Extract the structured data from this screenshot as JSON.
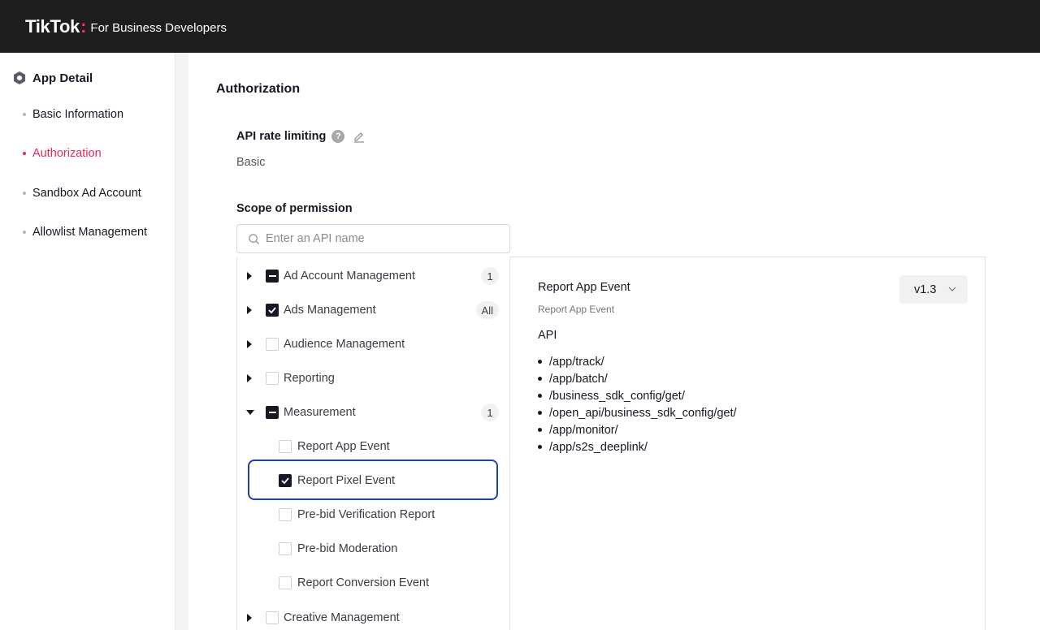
{
  "header": {
    "brand": "TikTok",
    "brand_dot": ":",
    "subtitle": "For Business Developers"
  },
  "sidebar": {
    "title": "App Detail",
    "items": [
      {
        "label": "Basic Information",
        "active": false
      },
      {
        "label": "Authorization",
        "active": true
      },
      {
        "label": "Sandbox Ad Account",
        "active": false
      },
      {
        "label": "Allowlist Management",
        "active": false
      }
    ]
  },
  "main": {
    "title": "Authorization",
    "rate_limit_label": "API rate limiting",
    "rate_limit_value": "Basic",
    "scope_label": "Scope of permission",
    "search_placeholder": "Enter an API name"
  },
  "tree": [
    {
      "label": "Ad Account Management",
      "state": "partial",
      "badge": "1",
      "expand": "collapsed"
    },
    {
      "label": "Ads Management",
      "state": "checked",
      "badge": "All",
      "expand": "collapsed"
    },
    {
      "label": "Audience Management",
      "state": "unchecked",
      "badge": "",
      "expand": "collapsed"
    },
    {
      "label": "Reporting",
      "state": "unchecked",
      "badge": "",
      "expand": "collapsed"
    },
    {
      "label": "Measurement",
      "state": "partial",
      "badge": "1",
      "expand": "expanded"
    },
    {
      "label": "Report App Event",
      "state": "unchecked",
      "child": true
    },
    {
      "label": "Report Pixel Event",
      "state": "checked",
      "child": true
    },
    {
      "label": "Pre-bid Verification Report",
      "state": "unchecked",
      "child": true
    },
    {
      "label": "Pre-bid Moderation",
      "state": "unchecked",
      "child": true
    },
    {
      "label": "Report Conversion Event",
      "state": "unchecked",
      "child": true
    },
    {
      "label": "Creative Management",
      "state": "unchecked",
      "badge": "",
      "expand": "collapsed"
    }
  ],
  "detail": {
    "title": "Report App Event",
    "subtitle": "Report App Event",
    "api_heading": "API",
    "apis": [
      "/app/track/",
      "/app/batch/",
      "/business_sdk_config/get/",
      "/open_api/business_sdk_config/get/",
      "/app/monitor/",
      "/app/s2s_deeplink/"
    ],
    "version": "v1.3"
  }
}
